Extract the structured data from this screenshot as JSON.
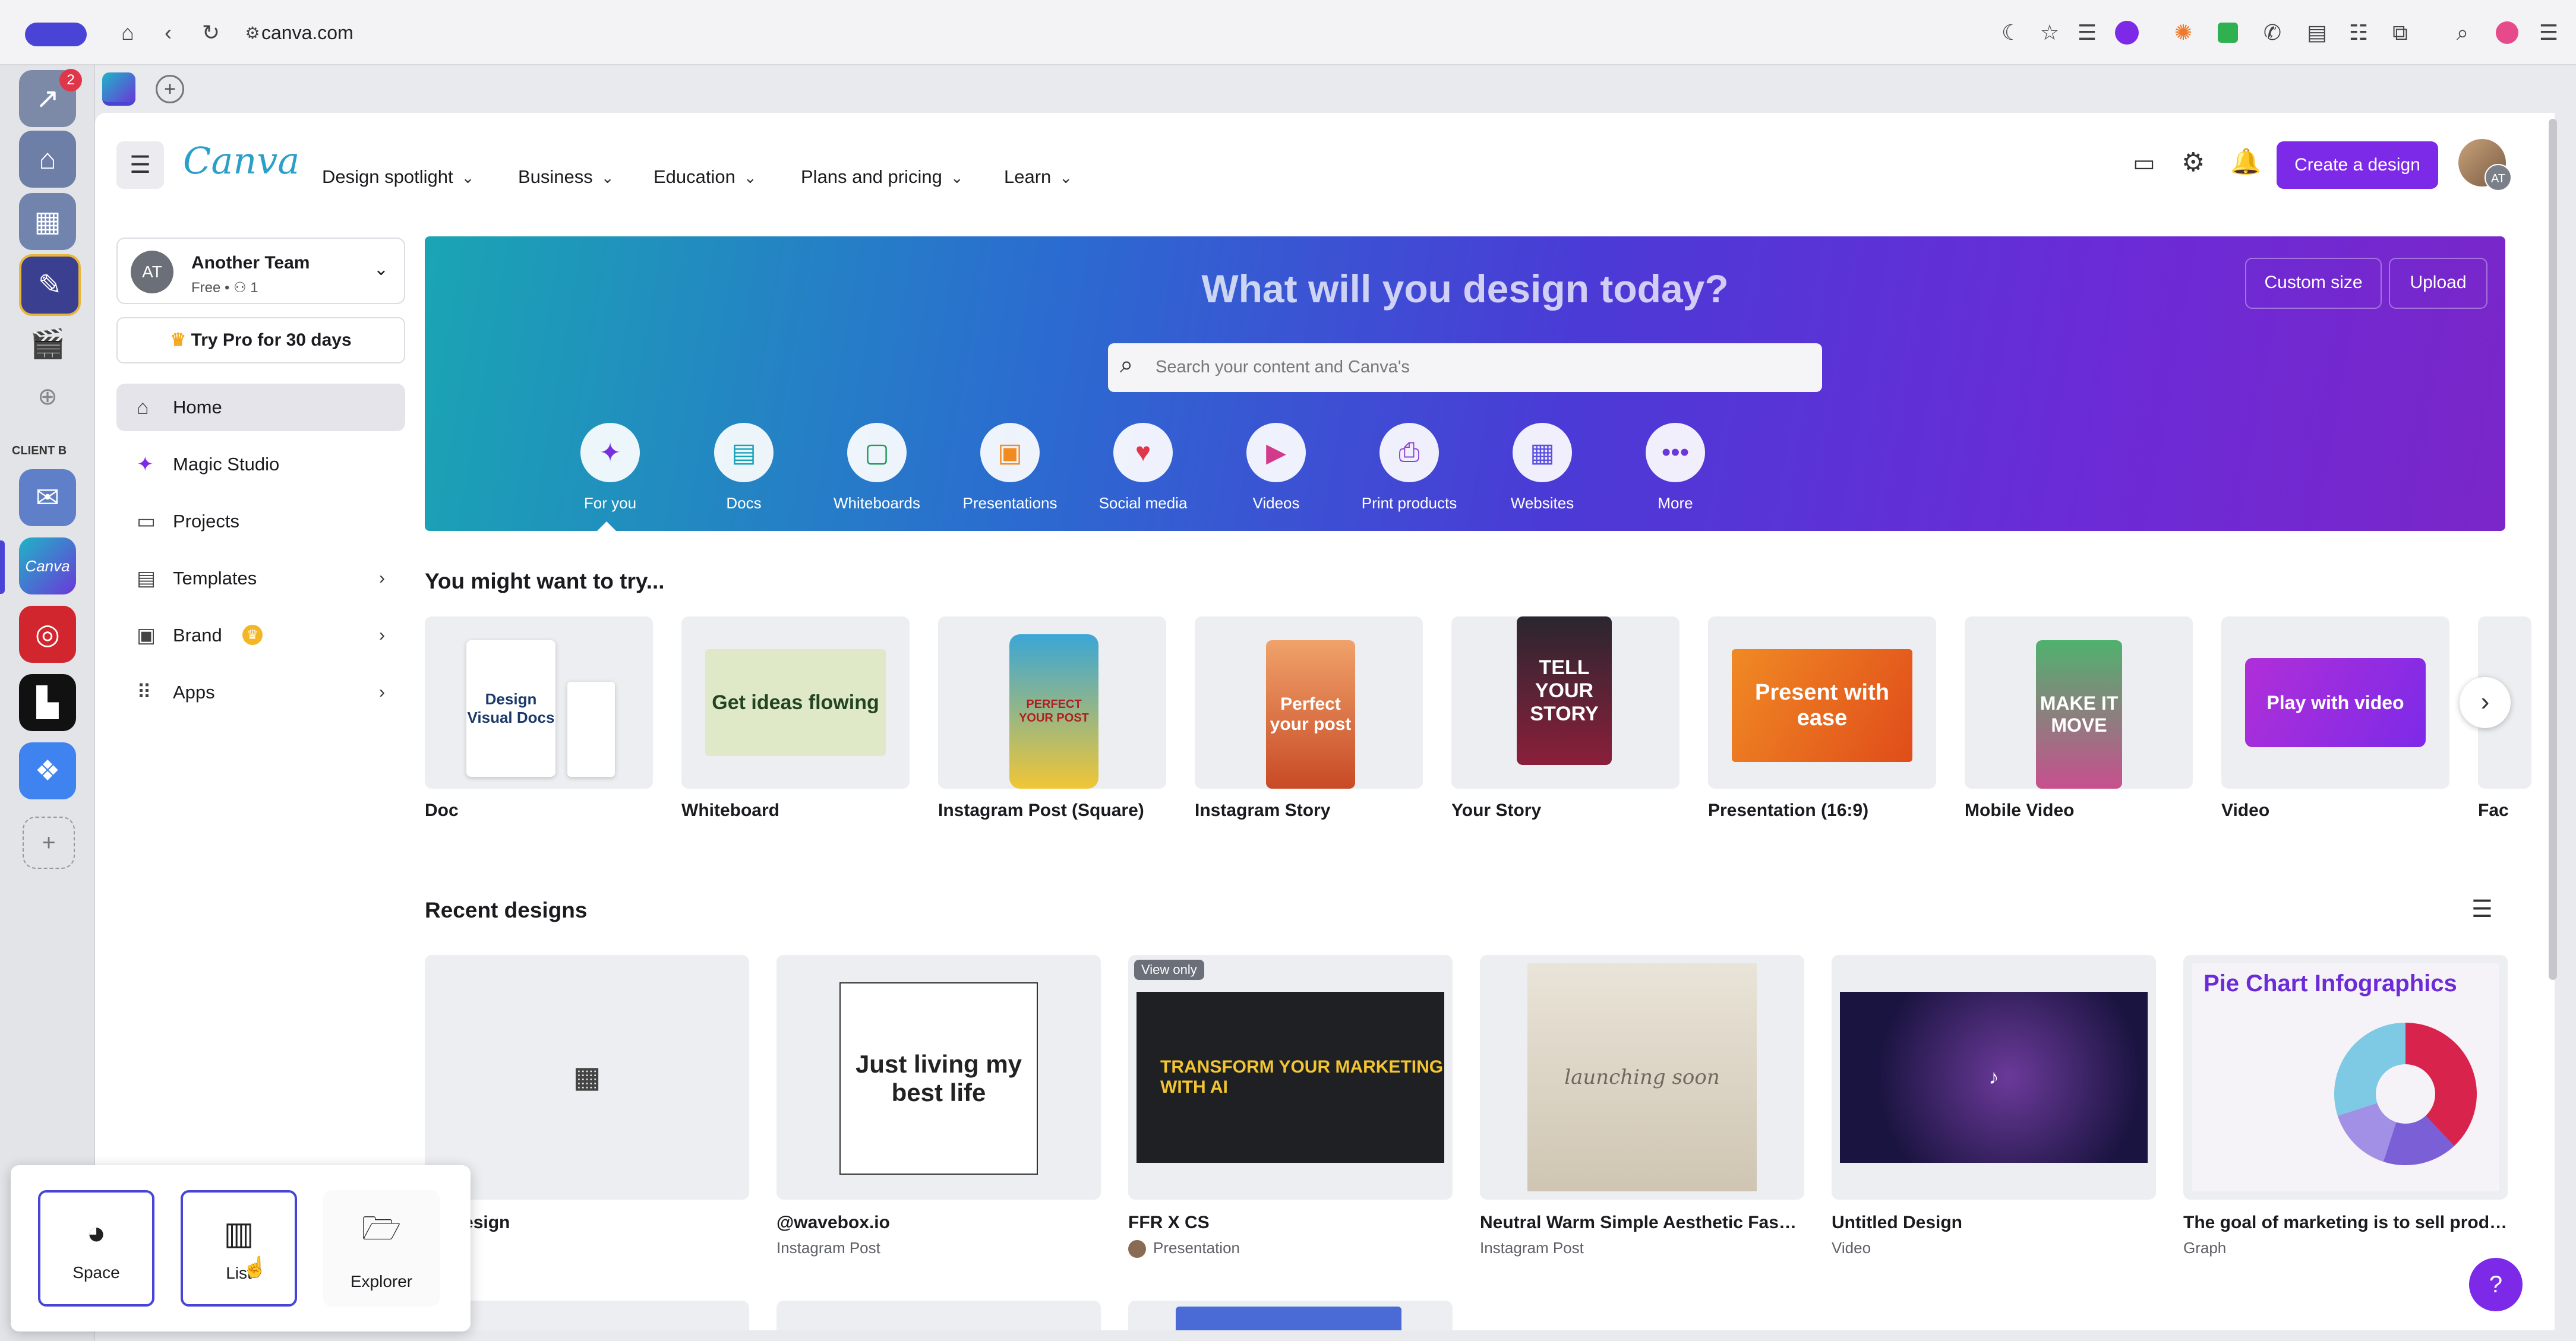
{
  "browser": {
    "url": "canva.com"
  },
  "rail": {
    "notification_count": "2",
    "section_label": "CLIENT B",
    "canva_icon_text": "Canva"
  },
  "header": {
    "logo": "Canva",
    "nav": [
      "Design spotlight",
      "Business",
      "Education",
      "Plans and pricing",
      "Learn"
    ],
    "create_label": "Create a design",
    "avatar_initials": "AT"
  },
  "sidebar": {
    "team_name": "Another Team",
    "team_initials": "AT",
    "team_meta": "Free • ",
    "team_members": "1",
    "try_pro": "Try Pro for 30 days",
    "items": [
      {
        "label": "Home"
      },
      {
        "label": "Magic Studio"
      },
      {
        "label": "Projects"
      },
      {
        "label": "Templates"
      },
      {
        "label": "Brand"
      },
      {
        "label": "Apps"
      }
    ]
  },
  "hero": {
    "title": "What will you design today?",
    "custom_size": "Custom size",
    "upload": "Upload",
    "search_placeholder": "Search your content and Canva's",
    "categories": [
      "For you",
      "Docs",
      "Whiteboards",
      "Presentations",
      "Social media",
      "Videos",
      "Print products",
      "Websites",
      "More"
    ]
  },
  "try_section": {
    "title": "You might want to try...",
    "items": [
      "Doc",
      "Whiteboard",
      "Instagram Post (Square)",
      "Instagram Story",
      "Your Story",
      "Presentation (16:9)",
      "Mobile Video",
      "Video",
      "Fac"
    ],
    "thumb_text": {
      "doc": "Design Visual Docs",
      "whiteboard": "Get ideas flowing",
      "insta_post": "PERFECT YOUR POST",
      "insta_story": "Perfect your post",
      "your_story": "TELL YOUR STORY",
      "presentation": "Present with ease",
      "mobile_video": "MAKE IT MOVE",
      "video": "Play with video"
    }
  },
  "recent": {
    "title": "Recent designs",
    "items": [
      {
        "title": "Untitled Design",
        "visible_title": "ed Design",
        "type": ""
      },
      {
        "title": "@wavebox.io",
        "type": "Instagram Post",
        "thumb_text": "Just living my best life"
      },
      {
        "title": "FFR X CS",
        "type": "Presentation",
        "badge": "View only",
        "thumb_text": "TRANSFORM YOUR MARKETING WITH AI"
      },
      {
        "title": "Neutral Warm Simple Aesthetic Fashi...",
        "type": "Instagram Post",
        "thumb_text": "launching soon"
      },
      {
        "title": "Untitled Design",
        "type": "Video"
      },
      {
        "title": "The goal of marketing is to sell produ...",
        "type": "Graph",
        "thumb_text": "Pie Chart Infographics"
      }
    ]
  },
  "popup": {
    "buttons": [
      "Space",
      "List",
      "Explorer"
    ]
  },
  "help_label": "?",
  "colors": {
    "brand_purple": "#7d2ae8",
    "hero_start": "#1aa5b3",
    "hero_end": "#7a26c9",
    "selected_nav_bg": "#e4e4ea"
  }
}
